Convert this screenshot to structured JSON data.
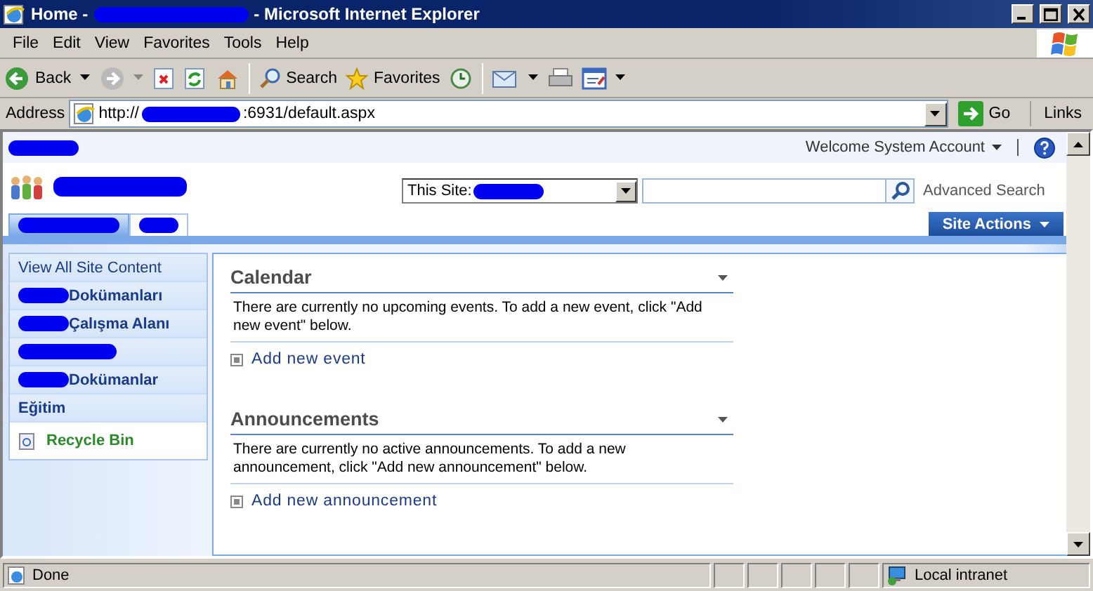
{
  "window": {
    "title_start": "Home -",
    "title_end": "- Microsoft Internet Explorer"
  },
  "menu": [
    "File",
    "Edit",
    "View",
    "Favorites",
    "Tools",
    "Help"
  ],
  "toolbar": {
    "back": "Back",
    "search": "Search",
    "favorites": "Favorites"
  },
  "address": {
    "label": "Address",
    "url_start": "http://",
    "url_end": ":6931/default.aspx",
    "go": "Go",
    "links": "Links"
  },
  "site": {
    "welcome": "Welcome System Account",
    "search_scope": "This Site:",
    "advanced_search": "Advanced Search",
    "site_actions": "Site Actions",
    "tabs": [
      {
        "selected": true
      },
      {
        "selected": false
      }
    ]
  },
  "quick_launch": [
    {
      "kind": "link",
      "label": "View All Site Content"
    },
    {
      "kind": "heading",
      "redacted": true,
      "label": "Dokümanları"
    },
    {
      "kind": "heading",
      "redacted": true,
      "label": "Çalışma Alanı"
    },
    {
      "kind": "heading",
      "redacted": true
    },
    {
      "kind": "heading",
      "redacted": true,
      "label": "Dokümanlar"
    },
    {
      "kind": "heading",
      "redacted": false,
      "label": "Eğitim"
    },
    {
      "kind": "recycle",
      "label": "Recycle Bin"
    }
  ],
  "web_parts": [
    {
      "title": "Calendar",
      "message": "There are currently no upcoming events. To add a new event, click \"Add new event\" below.",
      "action": "Add new event"
    },
    {
      "title": "Announcements",
      "message": "There are currently no active announcements. To add a new announcement, click \"Add new announcement\" below.",
      "action": "Add new announcement"
    }
  ],
  "status_bar": {
    "text": "Done",
    "zone": "Local intranet"
  }
}
